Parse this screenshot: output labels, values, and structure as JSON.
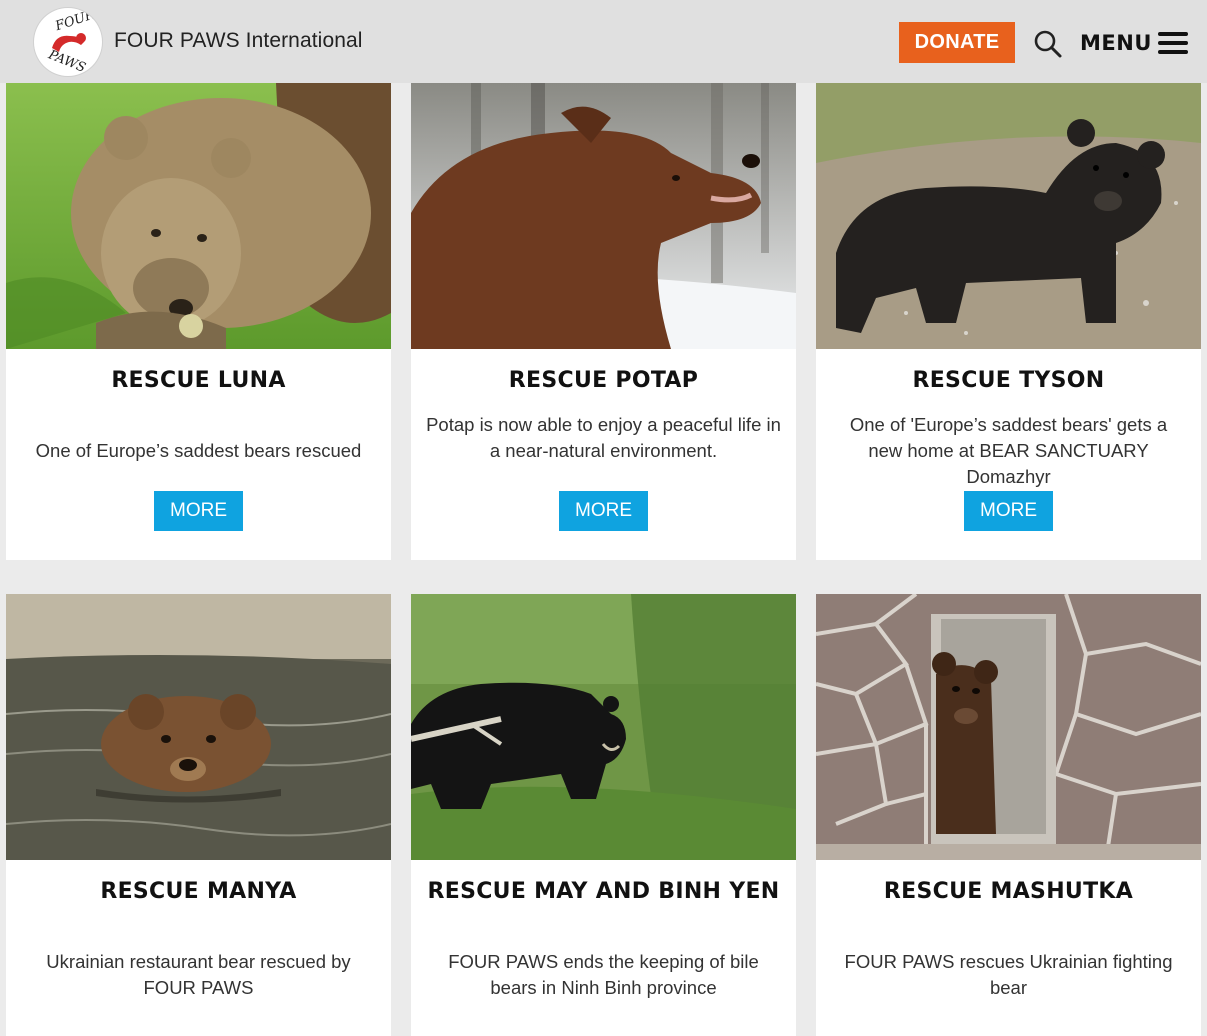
{
  "header": {
    "brand": "FOUR PAWS International",
    "logo_text_top": "FOUR",
    "logo_text_bottom": "PAWS",
    "donate_label": "DONATE",
    "menu_label": "MENU",
    "icons": [
      "search-icon",
      "hamburger-menu-icon"
    ],
    "colors": {
      "donate": "#e8611d",
      "more": "#0fa3e0",
      "logo_red": "#d42a2a"
    }
  },
  "cards": [
    {
      "title": "RESCUE LUNA",
      "desc": "One of Europe’s saddest bears rescued",
      "button": "MORE"
    },
    {
      "title": "RESCUE POTAP",
      "desc": "Potap is now able to enjoy a peaceful life in a near-natural environment.",
      "button": "MORE"
    },
    {
      "title": "RESCUE TYSON",
      "desc": "One of 'Europe’s saddest bears' gets a new home at BEAR SANCTUARY Domazhyr",
      "button": "MORE"
    },
    {
      "title": "RESCUE MANYA",
      "desc": "Ukrainian restaurant bear rescued by FOUR PAWS"
    },
    {
      "title": "RESCUE MAY AND BINH YEN",
      "desc": "FOUR PAWS ends the keeping of bile bears in Ninh Binh province"
    },
    {
      "title": "RESCUE MASHUTKA",
      "desc": "FOUR PAWS rescues Ukrainian fighting bear"
    }
  ]
}
